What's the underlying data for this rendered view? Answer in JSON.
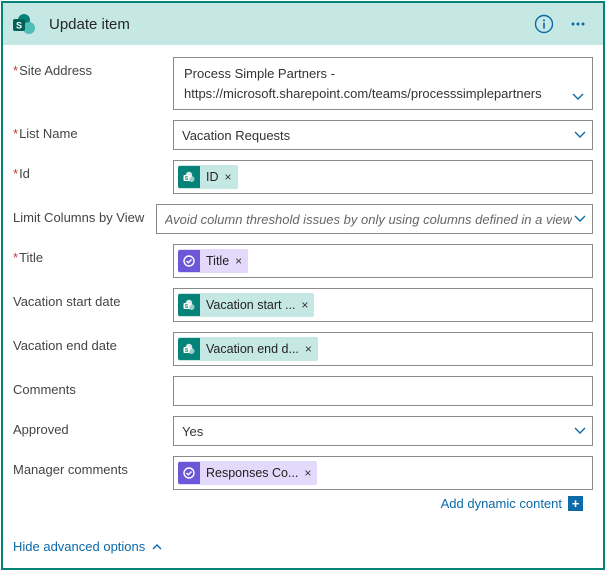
{
  "header": {
    "title": "Update item"
  },
  "labels": {
    "site_address": "Site Address",
    "list_name": "List Name",
    "id": "Id",
    "limit_view": "Limit Columns by View",
    "title": "Title",
    "vac_start": "Vacation start date",
    "vac_end": "Vacation end date",
    "comments": "Comments",
    "approved": "Approved",
    "manager_comments": "Manager comments"
  },
  "values": {
    "site_address_line1": "Process Simple Partners -",
    "site_address_line2": "https://microsoft.sharepoint.com/teams/processsimplepartners",
    "list_name": "Vacation Requests",
    "limit_view_placeholder": "Avoid column threshold issues by only using columns defined in a view",
    "approved": "Yes"
  },
  "tokens": {
    "id": "ID",
    "title": "Title",
    "vac_start": "Vacation start ...",
    "vac_end": "Vacation end d...",
    "responses": "Responses Co..."
  },
  "footer": {
    "add_dynamic_content": "Add dynamic content",
    "hide_advanced": "Hide advanced options"
  }
}
